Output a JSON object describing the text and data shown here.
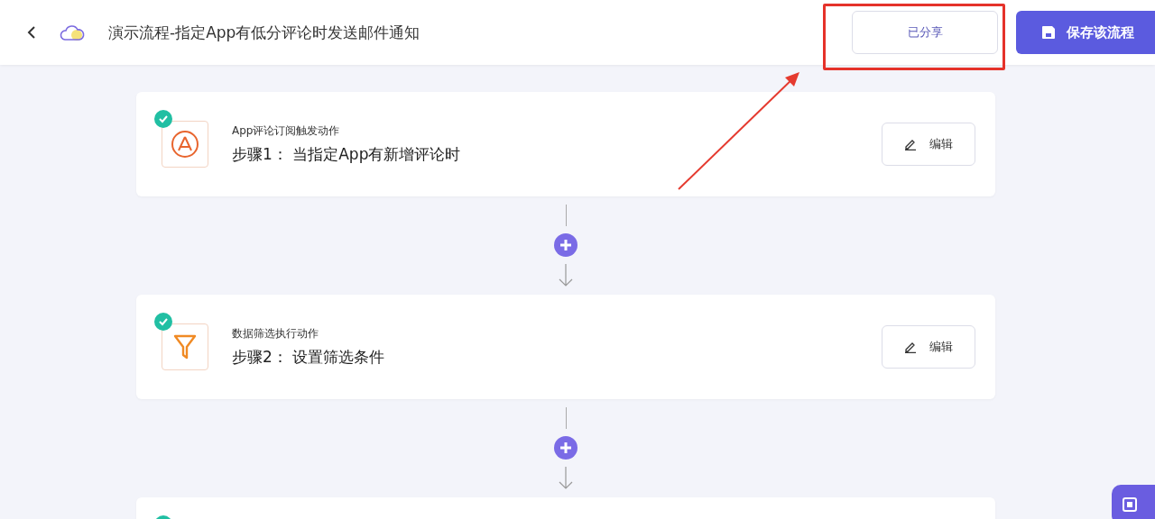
{
  "header": {
    "title": "演示流程-指定App有低分评论时发送邮件通知",
    "share_button": "已分享",
    "save_button": "保存该流程"
  },
  "steps": [
    {
      "kind": "app-store",
      "done": true,
      "caption": "App评论订阅触发动作",
      "title": "步骤1： 当指定App有新增评论时",
      "edit_button": "编辑"
    },
    {
      "kind": "filter",
      "done": true,
      "caption": "数据筛选执行动作",
      "title": "步骤2： 设置筛选条件",
      "edit_button": "编辑"
    },
    {
      "kind": "partial",
      "done": true
    }
  ],
  "annotation": {
    "shown": true
  }
}
